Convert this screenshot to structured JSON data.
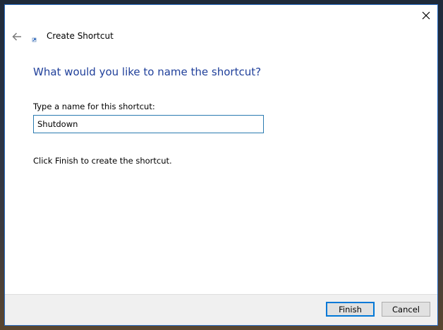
{
  "window": {
    "close_symbol": "×"
  },
  "header": {
    "title": "Create Shortcut",
    "back_icon": "back-arrow-icon",
    "wizard_icon": "shortcut-icon"
  },
  "content": {
    "main_instruction": "What would you like to name the shortcut?",
    "name_label": "Type a name for this shortcut:",
    "name_value": "Shutdown",
    "info_text": "Click Finish to create the shortcut."
  },
  "footer": {
    "finish_label": "Finish",
    "cancel_label": "Cancel"
  },
  "colors": {
    "instruction": "#1f3f9a",
    "window_border": "#2b6fc5",
    "input_border": "#2a7ab0",
    "primary_button_border": "#0078d7"
  }
}
